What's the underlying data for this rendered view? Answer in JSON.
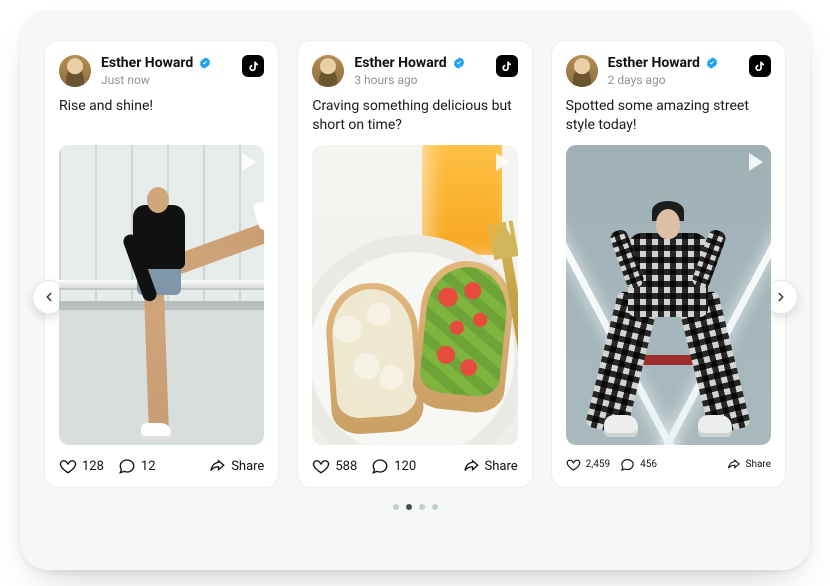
{
  "posts": [
    {
      "author": "Esther Howard",
      "verified": true,
      "time": "Just now",
      "platform": "tiktok",
      "caption": "Rise and shine!",
      "likes": "128",
      "comments": "12",
      "share_label": "Share"
    },
    {
      "author": "Esther Howard",
      "verified": true,
      "time": "3 hours ago",
      "platform": "tiktok",
      "caption": "Craving something delicious but short on time?",
      "likes": "588",
      "comments": "120",
      "share_label": "Share"
    },
    {
      "author": "Esther Howard",
      "verified": true,
      "time": "2 days ago",
      "platform": "tiktok",
      "caption": "Spotted some amazing street style today!",
      "likes": "2,459",
      "comments": "456",
      "share_label": "Share"
    }
  ],
  "carousel": {
    "dots": 4,
    "active_index": 1
  }
}
